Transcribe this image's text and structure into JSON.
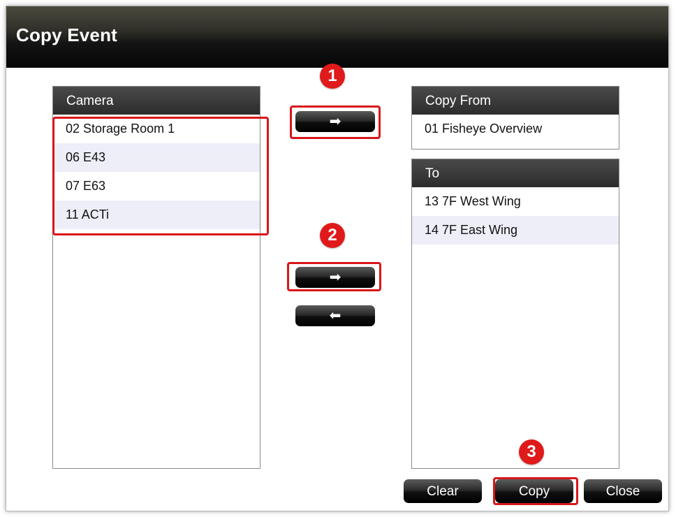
{
  "window": {
    "title": "Copy Event"
  },
  "camera_panel": {
    "header": "Camera",
    "items": [
      "02 Storage  Room 1",
      "06 E43",
      "07 E63",
      "11 ACTi"
    ]
  },
  "copy_from_panel": {
    "header": "Copy From",
    "items": [
      "01 Fisheye Overview"
    ]
  },
  "to_panel": {
    "header": "To",
    "items": [
      "13 7F  West Wing",
      "14 7F East Wing"
    ]
  },
  "arrows": {
    "copy_from_add": "➡",
    "to_add": "➡",
    "to_remove": "⬅"
  },
  "buttons": {
    "clear": "Clear",
    "copy": "Copy",
    "close": "Close"
  },
  "annotations": {
    "step1": "1",
    "step2": "2",
    "step3": "3"
  },
  "colors": {
    "highlight": "#d8161a",
    "badge": "#e01a1a",
    "alt_row": "#eeeef9"
  }
}
